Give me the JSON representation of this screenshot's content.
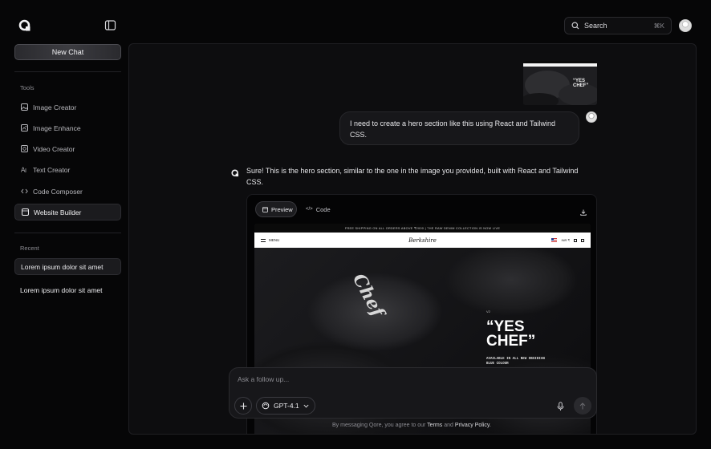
{
  "header": {
    "search_label": "Search",
    "search_shortcut": "⌘K"
  },
  "sidebar": {
    "new_chat_label": "New Chat",
    "tools_label": "Tools",
    "tools": [
      {
        "label": "Image Creator",
        "icon": "image-icon"
      },
      {
        "label": "Image Enhance",
        "icon": "image-enhance-icon"
      },
      {
        "label": "Video Creator",
        "icon": "video-icon"
      },
      {
        "label": "Text Creator",
        "icon": "text-icon"
      },
      {
        "label": "Code Composer",
        "icon": "code-icon"
      },
      {
        "label": "Website Builder",
        "icon": "website-icon",
        "active": true
      }
    ],
    "recent_label": "Recent",
    "recent": [
      {
        "label": "Lorem ipsum dolor sit amet",
        "active": true
      },
      {
        "label": "Lorem ipsum dolor sit amet",
        "active": false
      }
    ]
  },
  "chat": {
    "user_message": "I need to create a hero section like this using React and Tailwind CSS.",
    "ai_message": "Sure! This is the hero section, similar to the one in the image you provided, built with React and Tailwind CSS.",
    "preview_tab_label": "Preview",
    "code_tab_label": "Code"
  },
  "site_preview": {
    "banner": "FREE SHIPPING ON ALL ORDERS ABOVE ₹2000 | THE RAW DENIM COLLECTION IS NOW LIVE",
    "menu_label": "MENU",
    "brand": "Berkshire",
    "currency": "INR ₹",
    "cap_text": "Chef",
    "hero_small": "V2",
    "hero_headline": "“YES CHEF”",
    "hero_sub": "AVAILABLE IN ALL NEW OBSIDIAN BLUE COLOUR"
  },
  "composer": {
    "placeholder": "Ask a follow up...",
    "model": "GPT-4.1",
    "footer_prefix": "By messaging Qore, you agree to our",
    "terms_label": "Terms",
    "and_label": "and",
    "privacy_label": "Privacy Policy."
  },
  "colors": {
    "background": "#060607",
    "panel": "#0d0d0f",
    "bubble": "#17171a",
    "border": "#2a2a2e"
  }
}
